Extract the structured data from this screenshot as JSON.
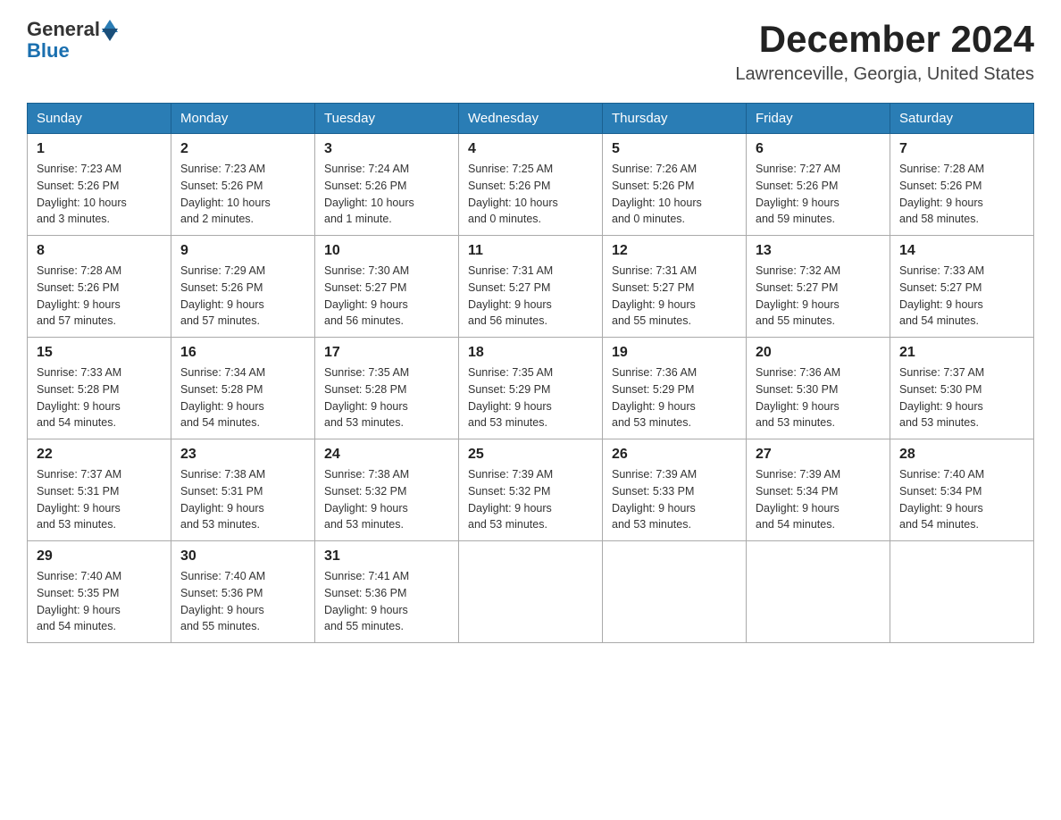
{
  "logo": {
    "general": "General",
    "blue": "Blue"
  },
  "title": "December 2024",
  "location": "Lawrenceville, Georgia, United States",
  "weekdays": [
    "Sunday",
    "Monday",
    "Tuesday",
    "Wednesday",
    "Thursday",
    "Friday",
    "Saturday"
  ],
  "weeks": [
    [
      {
        "day": "1",
        "info": "Sunrise: 7:23 AM\nSunset: 5:26 PM\nDaylight: 10 hours\nand 3 minutes."
      },
      {
        "day": "2",
        "info": "Sunrise: 7:23 AM\nSunset: 5:26 PM\nDaylight: 10 hours\nand 2 minutes."
      },
      {
        "day": "3",
        "info": "Sunrise: 7:24 AM\nSunset: 5:26 PM\nDaylight: 10 hours\nand 1 minute."
      },
      {
        "day": "4",
        "info": "Sunrise: 7:25 AM\nSunset: 5:26 PM\nDaylight: 10 hours\nand 0 minutes."
      },
      {
        "day": "5",
        "info": "Sunrise: 7:26 AM\nSunset: 5:26 PM\nDaylight: 10 hours\nand 0 minutes."
      },
      {
        "day": "6",
        "info": "Sunrise: 7:27 AM\nSunset: 5:26 PM\nDaylight: 9 hours\nand 59 minutes."
      },
      {
        "day": "7",
        "info": "Sunrise: 7:28 AM\nSunset: 5:26 PM\nDaylight: 9 hours\nand 58 minutes."
      }
    ],
    [
      {
        "day": "8",
        "info": "Sunrise: 7:28 AM\nSunset: 5:26 PM\nDaylight: 9 hours\nand 57 minutes."
      },
      {
        "day": "9",
        "info": "Sunrise: 7:29 AM\nSunset: 5:26 PM\nDaylight: 9 hours\nand 57 minutes."
      },
      {
        "day": "10",
        "info": "Sunrise: 7:30 AM\nSunset: 5:27 PM\nDaylight: 9 hours\nand 56 minutes."
      },
      {
        "day": "11",
        "info": "Sunrise: 7:31 AM\nSunset: 5:27 PM\nDaylight: 9 hours\nand 56 minutes."
      },
      {
        "day": "12",
        "info": "Sunrise: 7:31 AM\nSunset: 5:27 PM\nDaylight: 9 hours\nand 55 minutes."
      },
      {
        "day": "13",
        "info": "Sunrise: 7:32 AM\nSunset: 5:27 PM\nDaylight: 9 hours\nand 55 minutes."
      },
      {
        "day": "14",
        "info": "Sunrise: 7:33 AM\nSunset: 5:27 PM\nDaylight: 9 hours\nand 54 minutes."
      }
    ],
    [
      {
        "day": "15",
        "info": "Sunrise: 7:33 AM\nSunset: 5:28 PM\nDaylight: 9 hours\nand 54 minutes."
      },
      {
        "day": "16",
        "info": "Sunrise: 7:34 AM\nSunset: 5:28 PM\nDaylight: 9 hours\nand 54 minutes."
      },
      {
        "day": "17",
        "info": "Sunrise: 7:35 AM\nSunset: 5:28 PM\nDaylight: 9 hours\nand 53 minutes."
      },
      {
        "day": "18",
        "info": "Sunrise: 7:35 AM\nSunset: 5:29 PM\nDaylight: 9 hours\nand 53 minutes."
      },
      {
        "day": "19",
        "info": "Sunrise: 7:36 AM\nSunset: 5:29 PM\nDaylight: 9 hours\nand 53 minutes."
      },
      {
        "day": "20",
        "info": "Sunrise: 7:36 AM\nSunset: 5:30 PM\nDaylight: 9 hours\nand 53 minutes."
      },
      {
        "day": "21",
        "info": "Sunrise: 7:37 AM\nSunset: 5:30 PM\nDaylight: 9 hours\nand 53 minutes."
      }
    ],
    [
      {
        "day": "22",
        "info": "Sunrise: 7:37 AM\nSunset: 5:31 PM\nDaylight: 9 hours\nand 53 minutes."
      },
      {
        "day": "23",
        "info": "Sunrise: 7:38 AM\nSunset: 5:31 PM\nDaylight: 9 hours\nand 53 minutes."
      },
      {
        "day": "24",
        "info": "Sunrise: 7:38 AM\nSunset: 5:32 PM\nDaylight: 9 hours\nand 53 minutes."
      },
      {
        "day": "25",
        "info": "Sunrise: 7:39 AM\nSunset: 5:32 PM\nDaylight: 9 hours\nand 53 minutes."
      },
      {
        "day": "26",
        "info": "Sunrise: 7:39 AM\nSunset: 5:33 PM\nDaylight: 9 hours\nand 53 minutes."
      },
      {
        "day": "27",
        "info": "Sunrise: 7:39 AM\nSunset: 5:34 PM\nDaylight: 9 hours\nand 54 minutes."
      },
      {
        "day": "28",
        "info": "Sunrise: 7:40 AM\nSunset: 5:34 PM\nDaylight: 9 hours\nand 54 minutes."
      }
    ],
    [
      {
        "day": "29",
        "info": "Sunrise: 7:40 AM\nSunset: 5:35 PM\nDaylight: 9 hours\nand 54 minutes."
      },
      {
        "day": "30",
        "info": "Sunrise: 7:40 AM\nSunset: 5:36 PM\nDaylight: 9 hours\nand 55 minutes."
      },
      {
        "day": "31",
        "info": "Sunrise: 7:41 AM\nSunset: 5:36 PM\nDaylight: 9 hours\nand 55 minutes."
      },
      null,
      null,
      null,
      null
    ]
  ]
}
